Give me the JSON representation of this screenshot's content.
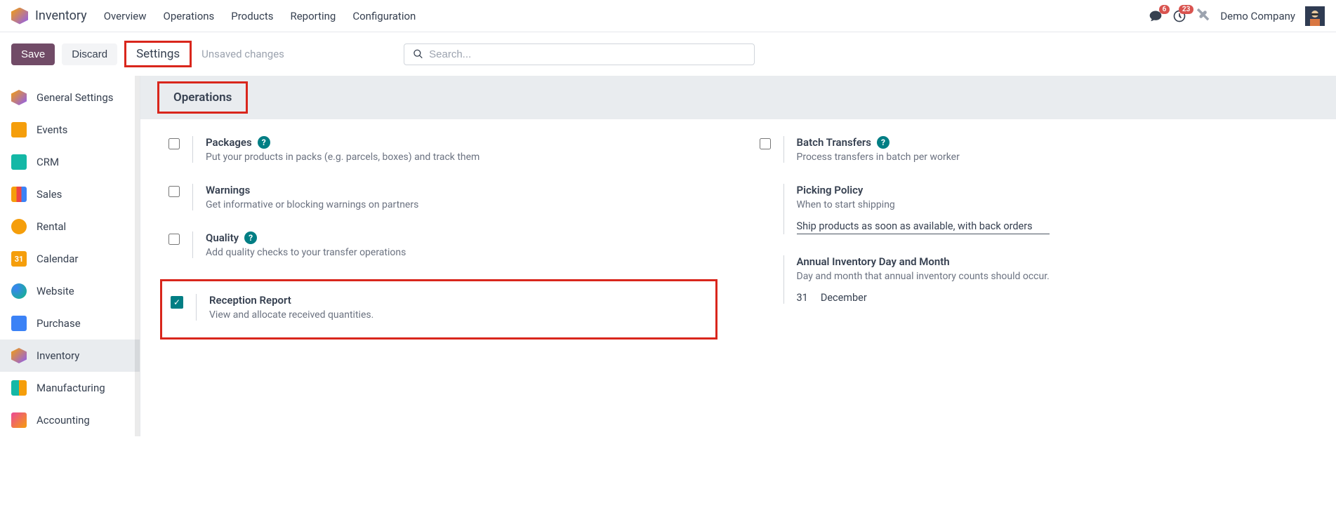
{
  "app": {
    "title": "Inventory"
  },
  "topnav": {
    "items": [
      "Overview",
      "Operations",
      "Products",
      "Reporting",
      "Configuration"
    ]
  },
  "topright": {
    "msg_badge": "6",
    "activity_badge": "23",
    "company": "Demo Company"
  },
  "controlbar": {
    "save": "Save",
    "discard": "Discard",
    "breadcrumb": "Settings",
    "unsaved": "Unsaved changes",
    "search_placeholder": "Search..."
  },
  "sidebar": {
    "items": [
      {
        "label": "General Settings"
      },
      {
        "label": "Events"
      },
      {
        "label": "CRM"
      },
      {
        "label": "Sales"
      },
      {
        "label": "Rental"
      },
      {
        "label": "Calendar"
      },
      {
        "label": "Website"
      },
      {
        "label": "Purchase"
      },
      {
        "label": "Inventory"
      },
      {
        "label": "Manufacturing"
      },
      {
        "label": "Accounting"
      }
    ]
  },
  "section": {
    "title": "Operations"
  },
  "settings": {
    "left": [
      {
        "title": "Packages",
        "desc": "Put your products in packs (e.g. parcels, boxes) and track them",
        "help": true,
        "checked": false
      },
      {
        "title": "Warnings",
        "desc": "Get informative or blocking warnings on partners",
        "help": false,
        "checked": false
      },
      {
        "title": "Quality",
        "desc": "Add quality checks to your transfer operations",
        "help": true,
        "checked": false
      },
      {
        "title": "Reception Report",
        "desc": "View and allocate received quantities.",
        "help": false,
        "checked": true
      }
    ],
    "right": [
      {
        "title": "Batch Transfers",
        "desc": "Process transfers in batch per worker",
        "help": true,
        "checked": false
      },
      {
        "title": "Picking Policy",
        "desc": "When to start shipping",
        "value": "Ship products as soon as available, with back orders"
      },
      {
        "title": "Annual Inventory Day and Month",
        "desc": "Day and month that annual inventory counts should occur.",
        "day": "31",
        "month": "December"
      }
    ]
  }
}
